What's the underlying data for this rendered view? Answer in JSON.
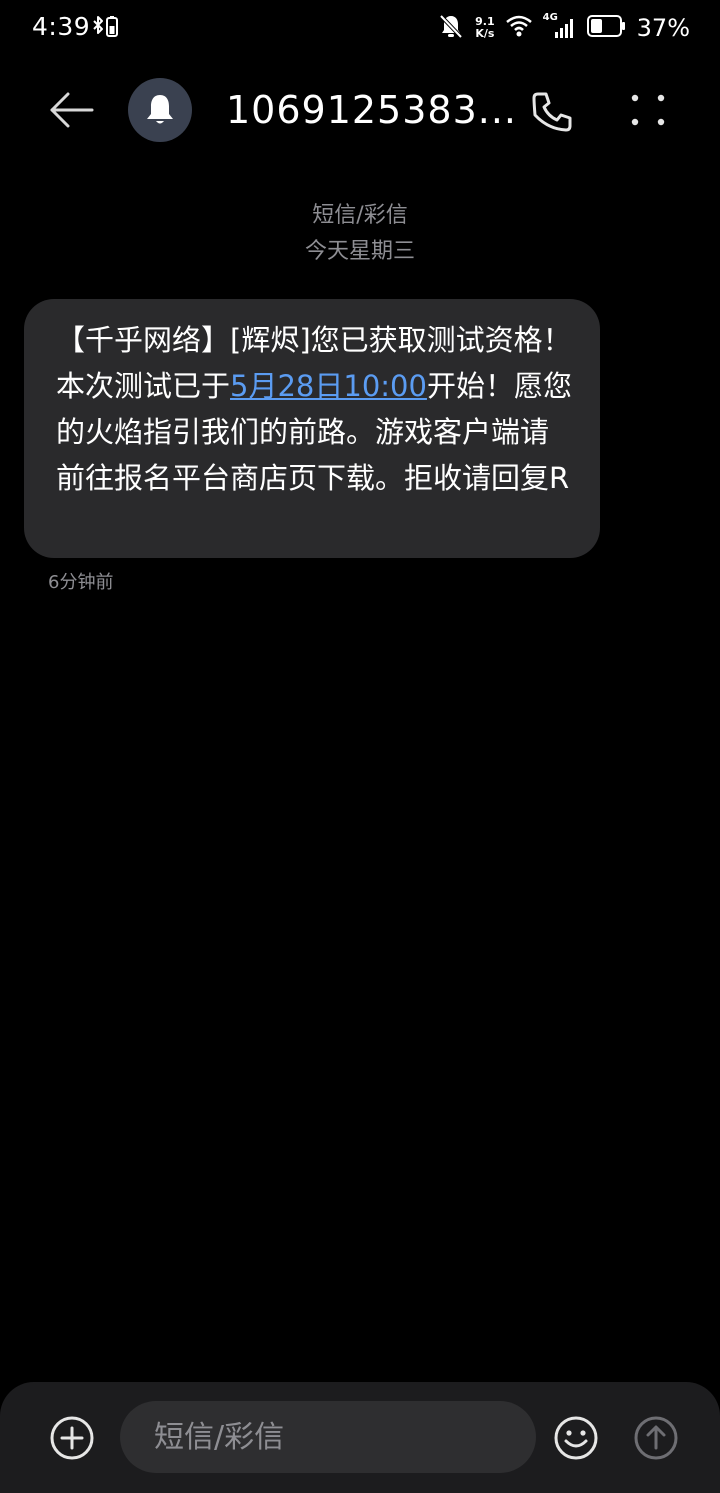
{
  "status_bar": {
    "time": "4:39",
    "net_speed_value": "9.1",
    "net_speed_unit": "K/s",
    "network_type": "4G",
    "battery": "37%"
  },
  "header": {
    "contact": "1069125383..."
  },
  "conversation": {
    "channel_label": "短信/彩信",
    "date_label": "今天星期三",
    "message": {
      "text_before": "【千乎网络】[辉烬]您已获取测试资格！本次测试已于",
      "link_text": "5月28日10:00",
      "text_after": "开始！愿您的火焰指引我们的前路。游戏客户端请前往报名平台商店页下载。拒收请回复R",
      "time": "6分钟前"
    }
  },
  "composer": {
    "placeholder": "短信/彩信"
  },
  "colors": {
    "background": "#000000",
    "bubble": "#2a2a2c",
    "link": "#5b9cf2",
    "secondary_text": "#8e8e93",
    "composer": "#1c1c1e",
    "avatar": "#3a4150"
  }
}
